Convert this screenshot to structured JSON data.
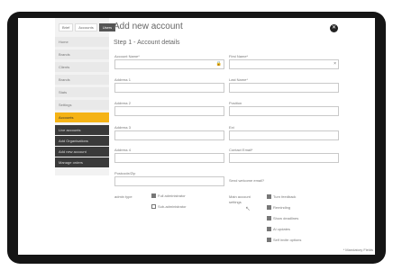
{
  "window": {
    "title": "Add new account",
    "step": "Step 1 - Account details"
  },
  "tabs": [
    "Brief",
    "Accounts",
    "Users"
  ],
  "sidebar": {
    "items": [
      "Home",
      "Brands",
      "Clients",
      "Brands",
      "Stats",
      "Settings"
    ],
    "highlighted": "Accounts",
    "dark_items": [
      "Live accounts",
      "Add Organisations",
      "Add new account",
      "Manage orders"
    ]
  },
  "form": {
    "account_name_label": "Account Name*",
    "first_name_label": "First Name*",
    "address1_label": "Address 1",
    "last_name_label": "Last Name*",
    "address2_label": "Address 2",
    "position_label": "Position",
    "address3_label": "Address 3",
    "ext_label": "Ext",
    "address4_label": "Address 4",
    "contact_email_label": "Contact Email*",
    "postcode_label": "Postcode/Zip",
    "send_welcome_label": "Send welcome email?",
    "admin_type_label": "admin type",
    "admin_type_options": [
      "Full administrator",
      "Sub-administrator"
    ],
    "settings_label": "Main account settings",
    "settings_options": [
      "Turn feedback",
      "Reminding",
      "Show deadlines",
      "Ai updates",
      "Self invite options"
    ]
  },
  "footer_note": "* Mandatory Fields"
}
